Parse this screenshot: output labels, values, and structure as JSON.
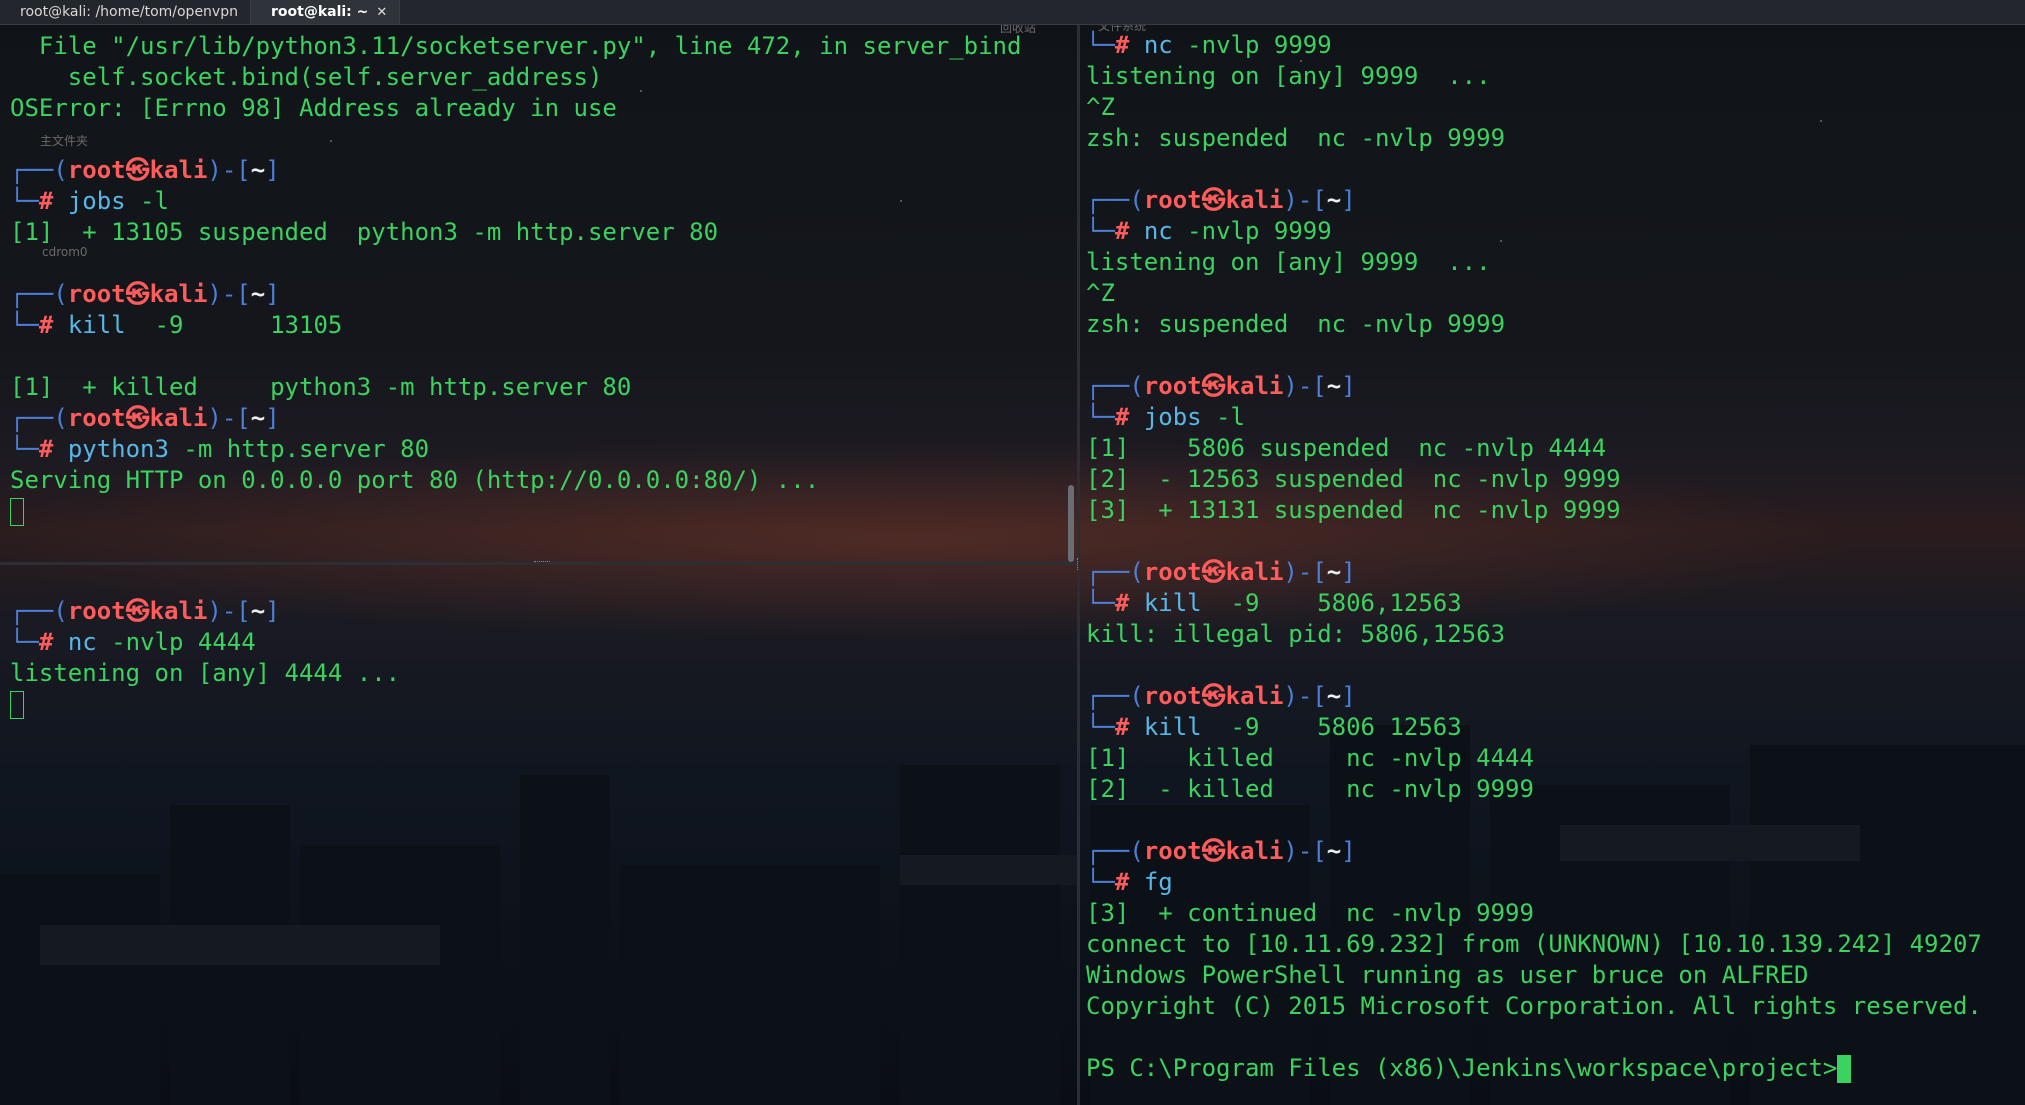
{
  "tabs": [
    {
      "title": "root@kali: /home/tom/openvpn",
      "active": false
    },
    {
      "title": "root@kali: ~",
      "active": true
    }
  ],
  "tab_close_glyph": "✕",
  "prompt": {
    "user": "root",
    "symbol": "㉿",
    "host": "kali",
    "dir": "~"
  },
  "desktop_labels": {
    "home_folder": "主文件夹",
    "cdrom": "cdrom0",
    "trash": "回收站",
    "filesystem": "文件系统"
  },
  "pane_top_left": {
    "l1": "  File \"/usr/lib/python3.11/socketserver.py\", line 472, in server_bind",
    "l2": "    self.socket.bind(self.server_address)",
    "l3": "OSError: [Errno 98] Address already in use",
    "c1_cmd": "jobs",
    "c1_args": " -l",
    "c1_out": "[1]  + 13105 suspended  python3 -m http.server 80",
    "c2_cmd": "kill",
    "c2_args": "  -9      13105",
    "c2_out": "[1]  + killed     python3 -m http.server 80",
    "c3_cmd": "python3",
    "c3_args": " -m http.server 80",
    "c3_out": "Serving HTTP on 0.0.0.0 port 80 (http://0.0.0.0:80/) ..."
  },
  "pane_bottom_left": {
    "c1_cmd": "nc",
    "c1_args": " -nvlp 4444",
    "c1_out": "listening on [any] 4444 ..."
  },
  "pane_right": {
    "c0_cmd": "nc",
    "c0_args": " -nvlp 9999",
    "c0_out1": "listening on [any] 9999  ...",
    "c0_out2": "^Z",
    "c0_out3": "zsh: suspended  nc -nvlp 9999",
    "c1_cmd": "nc",
    "c1_args": " -nvlp 9999",
    "c1_out1": "listening on [any] 9999  ...",
    "c1_out2": "^Z",
    "c1_out3": "zsh: suspended  nc -nvlp 9999",
    "c2_cmd": "jobs",
    "c2_args": " -l",
    "c2_out1": "[1]    5806 suspended  nc -nvlp 4444",
    "c2_out2": "[2]  - 12563 suspended  nc -nvlp 9999",
    "c2_out3": "[3]  + 13131 suspended  nc -nvlp 9999",
    "c3_cmd": "kill",
    "c3_args": "  -9    5806,12563",
    "c3_out": "kill: illegal pid: 5806,12563",
    "c4_cmd": "kill",
    "c4_args": "  -9    5806 12563",
    "c4_out1": "[1]    killed     nc -nvlp 4444",
    "c4_out2": "[2]  - killed     nc -nvlp 9999",
    "c5_cmd": "fg",
    "c5_out1": "[3]  + continued  nc -nvlp 9999",
    "c5_out2": "connect to [10.11.69.232] from (UNKNOWN) [10.10.139.242] 49207",
    "c5_out3": "Windows PowerShell running as user bruce on ALFRED",
    "c5_out4": "Copyright (C) 2015 Microsoft Corporation. All rights reserved.",
    "ps_prompt": "PS C:\\Program Files (x86)\\Jenkins\\workspace\\project>"
  },
  "colors": {
    "output_green": "#3bd25f",
    "command_blue": "#58b7e6",
    "prompt_red": "#ff5c5c",
    "frame_blue": "#4d7fd6"
  }
}
